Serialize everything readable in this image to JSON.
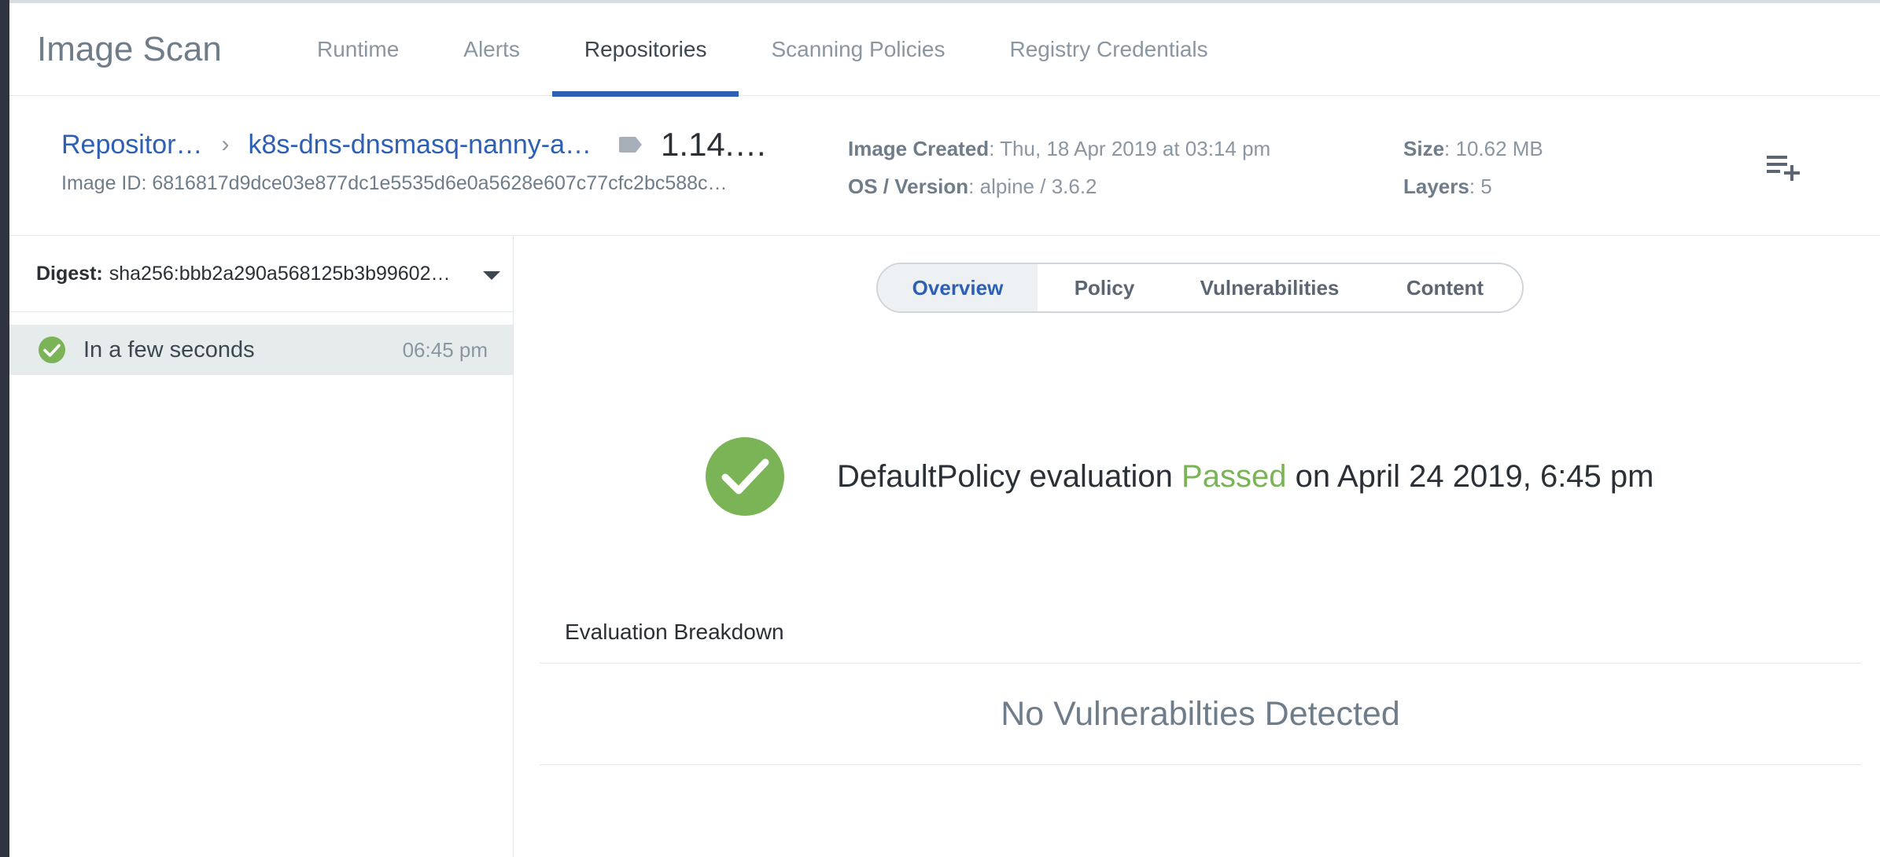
{
  "app": {
    "title": "Image Scan"
  },
  "nav": {
    "tabs": [
      {
        "label": "Runtime"
      },
      {
        "label": "Alerts"
      },
      {
        "label": "Repositories"
      },
      {
        "label": "Scanning Policies"
      },
      {
        "label": "Registry Credentials"
      }
    ],
    "active": "Repositories"
  },
  "image": {
    "breadcrumb_root": "Repositor…",
    "repository": "k8s-dns-dnsmasq-nanny-a…",
    "tag": "1.14.…",
    "image_id_label": "Image ID",
    "image_id": "6816817d9dce03e877dc1e5535d6e0a5628e607c77cfc2bc588c…",
    "created_label": "Image Created",
    "created": "Thu, 18 Apr 2019 at 03:14 pm",
    "os_label": "OS / Version",
    "os": "alpine / 3.6.2",
    "size_label": "Size",
    "size": "10.62 MB",
    "layers_label": "Layers",
    "layers": "5"
  },
  "digest": {
    "label": "Digest:",
    "value": "sha256:bbb2a290a568125b3b99602…"
  },
  "scans": [
    {
      "when": "In a few seconds",
      "time": "06:45 pm",
      "status": "passed"
    }
  ],
  "detail_tabs": [
    {
      "label": "Overview"
    },
    {
      "label": "Policy"
    },
    {
      "label": "Vulnerabilities"
    },
    {
      "label": "Content"
    }
  ],
  "detail_active": "Overview",
  "evaluation": {
    "prefix": "DefaultPolicy evaluation",
    "status": "Passed",
    "suffix": "on April 24 2019, 6:45 pm"
  },
  "breakdown": {
    "title": "Evaluation Breakdown",
    "empty_message": "No Vulnerabilties Detected"
  },
  "colors": {
    "accent": "#2d5fb5",
    "success": "#7ab457",
    "rail": "#2f3440"
  }
}
